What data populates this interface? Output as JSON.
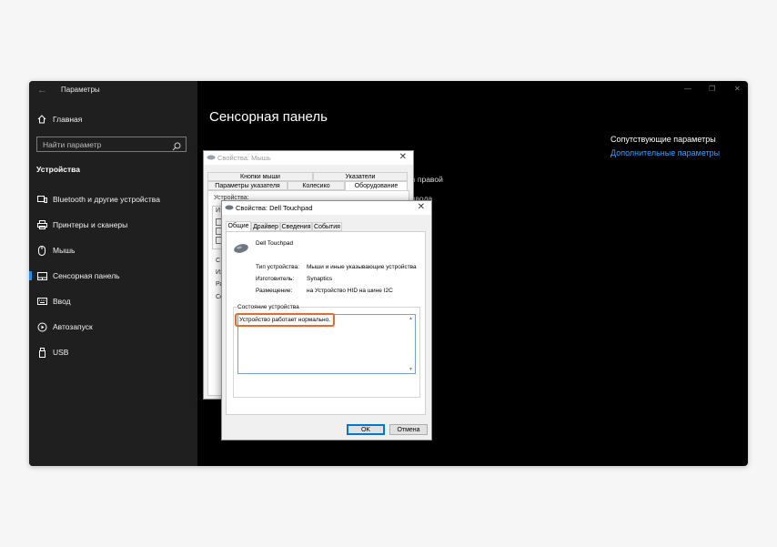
{
  "window": {
    "title": "Параметры",
    "controls": {
      "minimize": "—",
      "restore": "❐",
      "close": "✕"
    }
  },
  "sidebar": {
    "home": "Главная",
    "search_placeholder": "Найти параметр",
    "section": "Устройства",
    "items": [
      {
        "label": "Bluetooth и другие устройства",
        "icon": "bluetooth-devices-icon"
      },
      {
        "label": "Принтеры и сканеры",
        "icon": "printer-icon"
      },
      {
        "label": "Мышь",
        "icon": "mouse-icon"
      },
      {
        "label": "Сенсорная панель",
        "icon": "touchpad-icon",
        "active": true
      },
      {
        "label": "Ввод",
        "icon": "keyboard-icon"
      },
      {
        "label": "Автозапуск",
        "icon": "autoplay-icon"
      },
      {
        "label": "USB",
        "icon": "usb-icon"
      }
    ]
  },
  "main": {
    "title": "Сенсорная панель",
    "fragment1": "в правой",
    "fragment2": "ввода",
    "related_header": "Сопутствующие параметры",
    "related_link": "Дополнительные параметры"
  },
  "mouse_dialog": {
    "title": "Свойства: Мышь",
    "tabs_row1": [
      "Кнопки мыши",
      "Указатели"
    ],
    "tabs_row2": [
      "Параметры указателя",
      "Колесико",
      "Оборудование"
    ],
    "fragments": [
      "Устройства:",
      "И",
      "С",
      "Из",
      "Ра",
      "Со"
    ]
  },
  "touchpad_dialog": {
    "title": "Свойства: Dell Touchpad",
    "tabs": [
      "Общие",
      "Драйвер",
      "Сведения",
      "События"
    ],
    "device_name": "Dell Touchpad",
    "rows": [
      {
        "label": "Тип устройства:",
        "value": "Мыши и иные указывающие устройства"
      },
      {
        "label": "Изготовитель:",
        "value": "Synaptics"
      },
      {
        "label": "Размещение:",
        "value": "на Устройство HID на шине I2C"
      }
    ],
    "status_label": "Состояние устройства",
    "status_text": "Устройство работает нормально.",
    "ok": "OK",
    "cancel": "Отмена"
  },
  "colors": {
    "accent": "#1f8ef1",
    "link": "#3d9df2",
    "highlight": "#e86a2a"
  }
}
